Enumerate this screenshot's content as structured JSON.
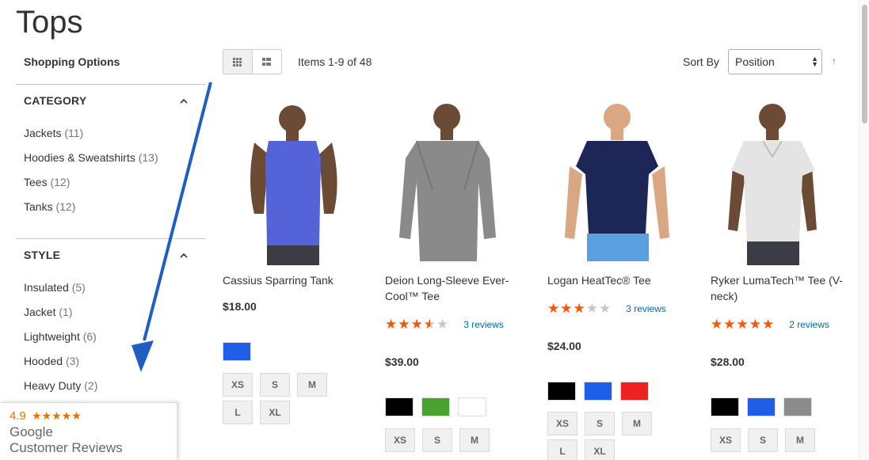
{
  "page": {
    "title": "Tops"
  },
  "sidebar": {
    "heading": "Shopping Options",
    "filters": [
      {
        "title": "CATEGORY",
        "items": [
          {
            "label": "Jackets",
            "count": "(11)"
          },
          {
            "label": "Hoodies & Sweatshirts",
            "count": "(13)"
          },
          {
            "label": "Tees",
            "count": "(12)"
          },
          {
            "label": "Tanks",
            "count": "(12)"
          }
        ]
      },
      {
        "title": "STYLE",
        "items": [
          {
            "label": "Insulated",
            "count": "(5)"
          },
          {
            "label": "Jacket",
            "count": "(1)"
          },
          {
            "label": "Lightweight",
            "count": "(6)"
          },
          {
            "label": "Hooded",
            "count": "(3)"
          },
          {
            "label": "Heavy Duty",
            "count": "(2)"
          }
        ]
      }
    ]
  },
  "toolbar": {
    "amount": "Items 1-9 of 48",
    "sort_label": "Sort By",
    "sort_value": "Position",
    "sort_dir": "↑"
  },
  "products": [
    {
      "name": "Cassius Sparring Tank",
      "price": "$18.00",
      "rating_fraction": null,
      "reviews": "",
      "colors": [
        "#1f5ee6"
      ],
      "sizes": [
        "XS",
        "S",
        "M",
        "L",
        "XL"
      ],
      "shirt_color": "#5563d8"
    },
    {
      "name": "Deion Long-Sleeve Ever-Cool™ Tee",
      "price": "$39.00",
      "rating_fraction": 0.7,
      "reviews": "3 reviews",
      "colors": [
        "#000000",
        "#4aa330",
        "#ffffff"
      ],
      "sizes": [
        "XS",
        "S",
        "M"
      ],
      "shirt_color": "#8a8a8a"
    },
    {
      "name": "Logan HeatTec® Tee",
      "price": "$24.00",
      "rating_fraction": 0.6,
      "reviews": "3 reviews",
      "colors": [
        "#000000",
        "#1f5ee6",
        "#ee2020"
      ],
      "sizes": [
        "XS",
        "S",
        "M",
        "L",
        "XL"
      ],
      "shirt_color": "#1d2757"
    },
    {
      "name": "Ryker LumaTech™ Tee (V-neck)",
      "price": "$28.00",
      "rating_fraction": 1.0,
      "reviews": "2 reviews",
      "colors": [
        "#000000",
        "#1f5ee6",
        "#8c8c8c"
      ],
      "sizes": [
        "XS",
        "S",
        "M"
      ],
      "shirt_color": "#e4e4e4"
    }
  ],
  "google_badge": {
    "rating": "4.9",
    "stars": "★★★★★",
    "line1": "Google",
    "line2": "Customer Reviews"
  },
  "stars_glyph": "★★★★★",
  "colors": {
    "accent_star": "#ff5501",
    "link": "#006bb4",
    "annotation_arrow": "#1f5fc4"
  }
}
